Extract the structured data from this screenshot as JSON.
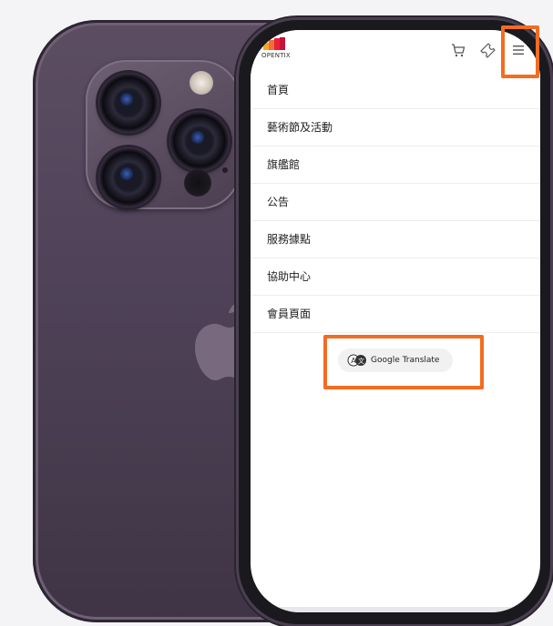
{
  "app": {
    "logo_text": "OPENTIX",
    "brand_colors": {
      "primary": "#e8213a",
      "secondary": "#f5a623",
      "highlight": "#f26d21"
    }
  },
  "header": {
    "icons": [
      "cart-icon",
      "ticket-icon",
      "hamburger-menu-icon"
    ]
  },
  "menu": {
    "items": [
      {
        "label": "首頁"
      },
      {
        "label": "藝術節及活動"
      },
      {
        "label": "旗艦館"
      },
      {
        "label": "公告"
      },
      {
        "label": "服務據點"
      },
      {
        "label": "協助中心"
      },
      {
        "label": "會員頁面"
      }
    ]
  },
  "translate": {
    "label": "Google Translate",
    "icon": "translate-icon"
  }
}
